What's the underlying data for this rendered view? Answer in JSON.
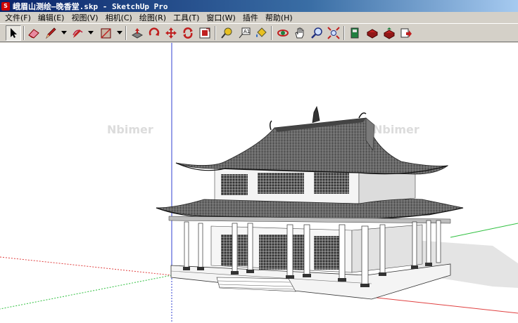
{
  "window": {
    "title": "峨眉山测绘—晚香堂.skp - SketchUp Pro"
  },
  "menu": {
    "items": [
      {
        "label": "文件(F)"
      },
      {
        "label": "编辑(E)"
      },
      {
        "label": "视图(V)"
      },
      {
        "label": "相机(C)"
      },
      {
        "label": "绘图(R)"
      },
      {
        "label": "工具(T)"
      },
      {
        "label": "窗口(W)"
      },
      {
        "label": "插件"
      },
      {
        "label": "帮助(H)"
      }
    ]
  },
  "toolbar": {
    "tools": [
      {
        "name": "select",
        "icon": "arrow-cursor-icon",
        "active": true
      },
      {
        "name": "eraser",
        "icon": "eraser-icon"
      },
      {
        "name": "pencil",
        "icon": "pencil-icon"
      },
      {
        "name": "arc",
        "icon": "arc-icon"
      },
      {
        "name": "rectangle",
        "icon": "rectangle-icon"
      },
      {
        "name": "push-pull",
        "icon": "push-pull-icon"
      },
      {
        "name": "rotate",
        "icon": "rotate-icon"
      },
      {
        "name": "move",
        "icon": "move-icon"
      },
      {
        "name": "follow-me",
        "icon": "follow-me-icon"
      },
      {
        "name": "offset",
        "icon": "offset-icon"
      },
      {
        "name": "tape-measure",
        "icon": "tape-measure-icon"
      },
      {
        "name": "text",
        "icon": "text-icon"
      },
      {
        "name": "paint-bucket",
        "icon": "paint-bucket-icon"
      },
      {
        "name": "orbit",
        "icon": "orbit-icon"
      },
      {
        "name": "pan",
        "icon": "pan-hand-icon"
      },
      {
        "name": "zoom",
        "icon": "zoom-icon"
      },
      {
        "name": "zoom-extents",
        "icon": "zoom-extents-icon"
      },
      {
        "name": "components",
        "icon": "components-icon"
      },
      {
        "name": "get-models",
        "icon": "get-models-icon"
      },
      {
        "name": "share-model",
        "icon": "share-model-icon"
      },
      {
        "name": "send-to-layout",
        "icon": "send-to-layout-icon"
      }
    ]
  },
  "viewport": {
    "watermark": "Nbimer",
    "colors": {
      "background": "#ffffff",
      "blue_axis": "#3040d0",
      "green_axis": "#30c040",
      "red_axis": "#e04040",
      "roof": "#555555",
      "wall": "#f0f0f0"
    }
  }
}
